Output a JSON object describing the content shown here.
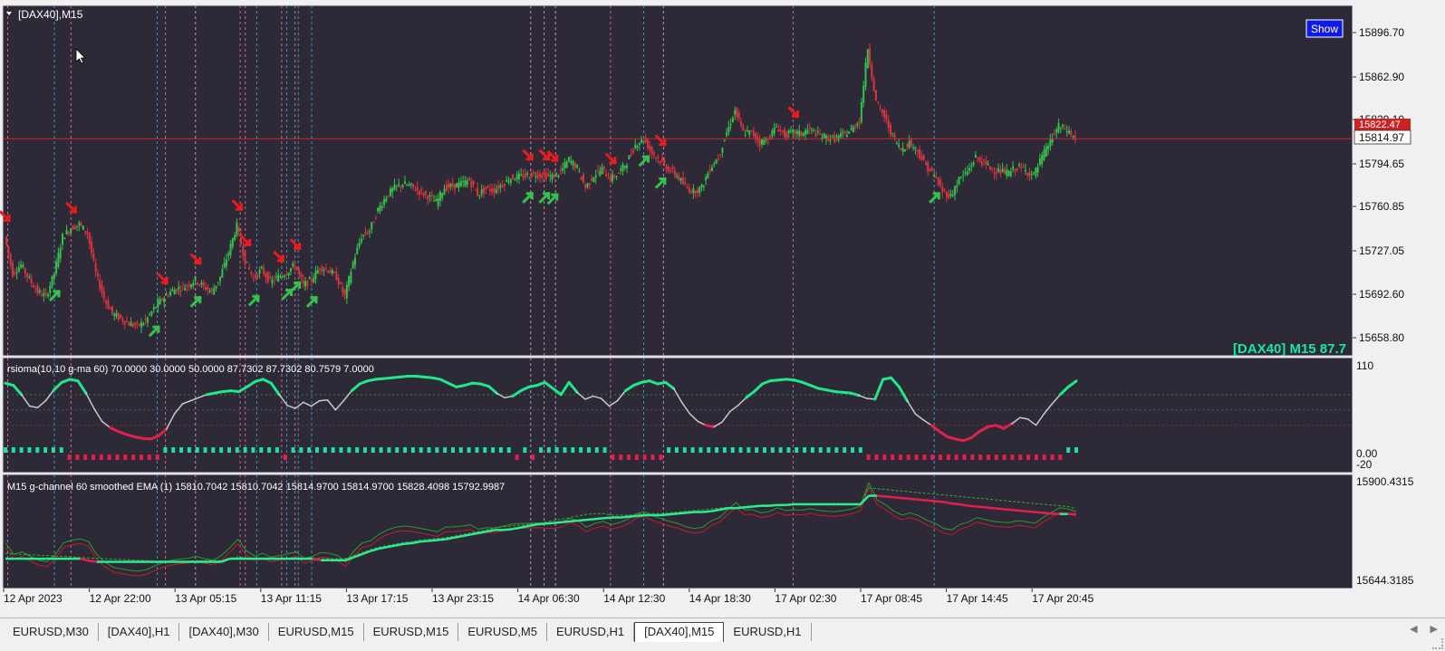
{
  "window": {
    "symbol_label": "[DAX40],M15",
    "show_button": "Show"
  },
  "colors": {
    "bg": "#2d2936",
    "frame": "#d8d8d8",
    "bull": "#35c24a",
    "bear": "#d9343f",
    "vline_blue": "#3aa8e0",
    "vline_pink": "#d47aa0",
    "price_line": "#cc2a2a",
    "rsi_green": "#20e88a",
    "rsi_gray": "#c9c9c9",
    "rsi_red": "#e2204c",
    "ema_green": "#2dec90",
    "ema_red": "#e2204c",
    "env_green": "#3aa83a"
  },
  "chart_data": [
    {
      "type": "candlestick",
      "name": "[DAX40],M15",
      "ylim": [
        15645,
        15915
      ],
      "y_ticks": [
        "15896.70",
        "15862.90",
        "15829.10",
        "15794.65",
        "15760.85",
        "15727.05",
        "15692.60",
        "15658.80"
      ],
      "current_price": "15814.97",
      "current_price_value": 15814.97,
      "bid_label": "15822.47",
      "corner_label": "[DAX40] M15  87.7",
      "x_labels": [
        "12 Apr 2023",
        "12 Apr 22:00",
        "13 Apr 05:15",
        "13 Apr 11:15",
        "13 Apr 17:15",
        "13 Apr 23:15",
        "14 Apr 06:30",
        "14 Apr 12:30",
        "14 Apr 18:30",
        "17 Apr 02:30",
        "17 Apr 08:45",
        "17 Apr 14:45",
        "17 Apr 20:45"
      ],
      "close_path": [
        15735,
        15705,
        15712,
        15700,
        15690,
        15686,
        15705,
        15735,
        15742,
        15745,
        15738,
        15705,
        15685,
        15672,
        15668,
        15664,
        15662,
        15666,
        15676,
        15684,
        15690,
        15693,
        15695,
        15700,
        15694,
        15690,
        15702,
        15722,
        15744,
        15715,
        15701,
        15708,
        15698,
        15702,
        15706,
        15712,
        15695,
        15700,
        15710,
        15708,
        15702,
        15686,
        15714,
        15735,
        15740,
        15757,
        15768,
        15775,
        15778,
        15776,
        15772,
        15768,
        15763,
        15775,
        15776,
        15778,
        15781,
        15770,
        15774,
        15773,
        15778,
        15783,
        15784,
        15785,
        15786,
        15785,
        15784,
        15788,
        15798,
        15791,
        15775,
        15785,
        15790,
        15782,
        15787,
        15796,
        15810,
        15815,
        15804,
        15797,
        15790,
        15785,
        15776,
        15772,
        15775,
        15791,
        15800,
        15820,
        15838,
        15820,
        15820,
        15812,
        15815,
        15825,
        15818,
        15820,
        15819,
        15823,
        15818,
        15816,
        15815,
        15818,
        15822,
        15830,
        15889,
        15845,
        15833,
        15817,
        15806,
        15812,
        15805,
        15793,
        15785,
        15772,
        15768,
        15782,
        15788,
        15800,
        15795,
        15790,
        15788,
        15787,
        15792,
        15789,
        15785,
        15800,
        15813,
        15825,
        15822,
        15814.97
      ],
      "arrows_up": [
        6,
        18,
        23,
        30,
        34,
        35,
        37,
        63,
        65,
        66,
        77,
        79,
        112
      ],
      "arrows_down": [
        0,
        8,
        19,
        23,
        28,
        29,
        33,
        35,
        63,
        65,
        66,
        73,
        79,
        95
      ]
    },
    {
      "type": "line",
      "name": "rsioma",
      "header": "rsioma(10,10 g-ma 60) 70.0000 30.0000 50.0000 87.7302 87.7302 80.7579 7.0000",
      "y_ticks": [
        "110",
        "0.00",
        "-20"
      ],
      "ylim": [
        -20,
        110
      ],
      "levels": [
        70,
        30,
        50
      ],
      "values": [
        85,
        82,
        70,
        55,
        53,
        62,
        76,
        86,
        90,
        88,
        72,
        52,
        35,
        27,
        22,
        18,
        15,
        13,
        12,
        16,
        25,
        45,
        58,
        62,
        66,
        70,
        72,
        74,
        75,
        74,
        80,
        87,
        90,
        85,
        70,
        56,
        52,
        60,
        55,
        62,
        63,
        50,
        62,
        75,
        84,
        88,
        90,
        91,
        92,
        93,
        94,
        94,
        93,
        92,
        90,
        85,
        80,
        82,
        85,
        84,
        81,
        72,
        66,
        68,
        75,
        80,
        82,
        86,
        78,
        70,
        86,
        73,
        64,
        68,
        65,
        55,
        62,
        75,
        82,
        86,
        88,
        84,
        86,
        78,
        60,
        45,
        35,
        30,
        28,
        34,
        48,
        56,
        66,
        74,
        84,
        88,
        89,
        90,
        89,
        86,
        82,
        78,
        76,
        74,
        73,
        72,
        69,
        65,
        64,
        90,
        92,
        80,
        62,
        45,
        37,
        30,
        22,
        15,
        12,
        10,
        14,
        22,
        28,
        30,
        26,
        32,
        40,
        38,
        30,
        45,
        58,
        70,
        80,
        87.73
      ],
      "bar_states": [
        0,
        0,
        0,
        0,
        0,
        0,
        0,
        0,
        1,
        1,
        1,
        1,
        1,
        1,
        1,
        1,
        1,
        1,
        1,
        1,
        0,
        0,
        0,
        0,
        0,
        0,
        0,
        0,
        0,
        0,
        0,
        0,
        0,
        0,
        0,
        1,
        0,
        0,
        0,
        0,
        0,
        0,
        0,
        0,
        0,
        0,
        0,
        0,
        0,
        0,
        0,
        0,
        0,
        0,
        0,
        0,
        0,
        0,
        0,
        0,
        0,
        0,
        0,
        0,
        1,
        0,
        1,
        0,
        0,
        0,
        0,
        0,
        0,
        0,
        0,
        0,
        1,
        1,
        1,
        1,
        1,
        1,
        1,
        0,
        0,
        0,
        0,
        0,
        0,
        0,
        0,
        0,
        0,
        0,
        0,
        0,
        0,
        0,
        0,
        0,
        0,
        0,
        0,
        0,
        0,
        0,
        0,
        0,
        1,
        1,
        1,
        1,
        1,
        1,
        1,
        1,
        1,
        1,
        1,
        1,
        1,
        1,
        1,
        1,
        1,
        1,
        1,
        1,
        1,
        1,
        1,
        1,
        1,
        0,
        0
      ]
    },
    {
      "type": "line",
      "name": "M15 g-channel",
      "header": "M15 g-channel  60 smoothed EMA (1) 15810.7042 15810.7042 15814.9700 15814.9700 15828.4098 15792.9987",
      "y_ticks": [
        "15900.4315",
        "15644.3185"
      ],
      "ylim": [
        15644.3185,
        15900.4315
      ],
      "ema_values": [
        15700,
        15700,
        15700,
        15700,
        15700,
        15700,
        15700,
        15700,
        15700,
        15700,
        15695,
        15692,
        15692,
        15692,
        15692,
        15692,
        15692,
        15692,
        15692,
        15692,
        15692,
        15692,
        15692,
        15692,
        15692,
        15692,
        15692,
        15700,
        15700,
        15700,
        15700,
        15700,
        15700,
        15700,
        15700,
        15700,
        15700,
        15700,
        15696,
        15696,
        15696,
        15696,
        15704,
        15712,
        15720,
        15726,
        15730,
        15734,
        15738,
        15740,
        15744,
        15746,
        15748,
        15750,
        15754,
        15758,
        15762,
        15766,
        15770,
        15774,
        15774,
        15776,
        15780,
        15784,
        15788,
        15790,
        15792,
        15794,
        15796,
        15798,
        15800,
        15802,
        15804,
        15806,
        15806,
        15808,
        15810,
        15812,
        15812,
        15812,
        15814,
        15816,
        15818,
        15820,
        15820,
        15822,
        15826,
        15830,
        15830,
        15832,
        15834,
        15836,
        15836,
        15838,
        15838,
        15840,
        15840,
        15840,
        15840,
        15840,
        15840,
        15840,
        15840,
        15840,
        15862,
        15862,
        15860,
        15858,
        15856,
        15854,
        15852,
        15850,
        15848,
        15846,
        15842,
        15840,
        15836,
        15834,
        15832,
        15830,
        15828,
        15826,
        15824,
        15822,
        15820,
        15818,
        15816,
        15815,
        15815,
        15814.97
      ],
      "upper_values": [
        15714,
        15713,
        15711,
        15710,
        15709,
        15708,
        15707,
        15706,
        15705,
        15703,
        15702,
        15701,
        15700,
        15699,
        15698,
        15697,
        15696,
        15695,
        15694,
        15694,
        15694,
        15694,
        15694,
        15695,
        15695,
        15695,
        15695,
        15700,
        15705,
        15702,
        15702,
        15702,
        15702,
        15702,
        15702,
        15702,
        15702,
        15702,
        15700,
        15700,
        15700,
        15701,
        15708,
        15716,
        15724,
        15730,
        15734,
        15738,
        15742,
        15744,
        15748,
        15750,
        15752,
        15754,
        15758,
        15762,
        15766,
        15770,
        15774,
        15780,
        15782,
        15784,
        15786,
        15788,
        15790,
        15794,
        15798,
        15802,
        15806,
        15810,
        15814,
        15816,
        15816,
        15812,
        15812,
        15812,
        15814,
        15816,
        15816,
        15816,
        15818,
        15820,
        15822,
        15824,
        15826,
        15828,
        15830,
        15832,
        15832,
        15834,
        15836,
        15838,
        15838,
        15840,
        15840,
        15842,
        15842,
        15842,
        15842,
        15842,
        15842,
        15842,
        15842,
        15842,
        15882,
        15880,
        15878,
        15876,
        15874,
        15872,
        15870,
        15868,
        15866,
        15864,
        15862,
        15860,
        15858,
        15856,
        15854,
        15852,
        15850,
        15848,
        15846,
        15844,
        15842,
        15840,
        15838,
        15836,
        15834,
        15828.41
      ]
    }
  ]
}
